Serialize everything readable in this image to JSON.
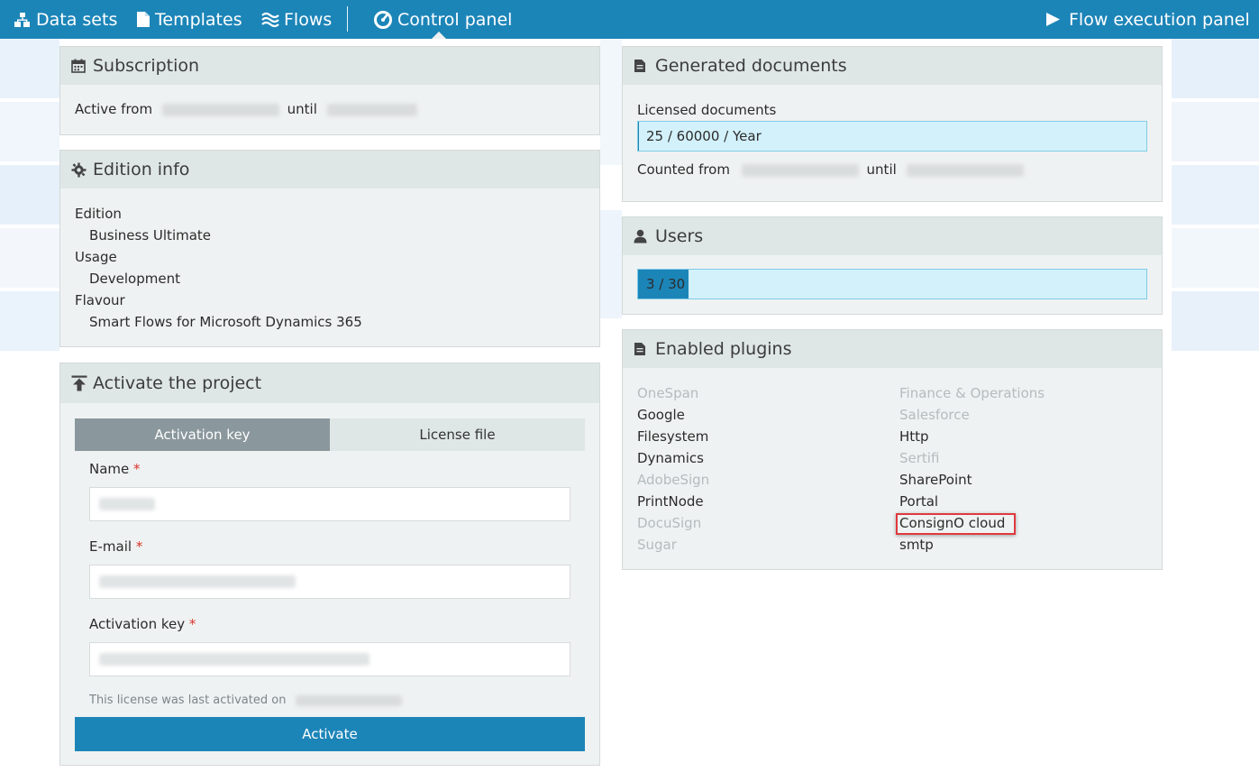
{
  "nav": {
    "items": [
      {
        "label": "Data sets",
        "icon": "sitemap-icon"
      },
      {
        "label": "Templates",
        "icon": "file-icon"
      },
      {
        "label": "Flows",
        "icon": "waves-icon"
      },
      {
        "label": "Control panel",
        "icon": "gauge-icon"
      }
    ],
    "right": {
      "label": "Flow execution panel",
      "icon": "play-icon"
    }
  },
  "subscription": {
    "title": "Subscription",
    "active_from_label": "Active from",
    "until_label": "until"
  },
  "edition": {
    "title": "Edition info",
    "edition_label": "Edition",
    "edition_value": "Business Ultimate",
    "usage_label": "Usage",
    "usage_value": "Development",
    "flavour_label": "Flavour",
    "flavour_value": "Smart Flows for Microsoft Dynamics 365"
  },
  "activate": {
    "title": "Activate the project",
    "tabs": [
      "Activation key",
      "License file"
    ],
    "active_tab": 0,
    "name_label": "Name",
    "email_label": "E-mail",
    "key_label": "Activation key",
    "required_mark": "*",
    "last_activated": "This license was last activated on",
    "button": "Activate"
  },
  "documents": {
    "title": "Generated documents",
    "licensed_label": "Licensed documents",
    "licensed_value": "25 / 60000 / Year",
    "used_fraction": 0.0004,
    "counted_from_label": "Counted from",
    "until_label": "until"
  },
  "users": {
    "title": "Users",
    "value": "3 / 30",
    "fraction": 0.1
  },
  "plugins": {
    "title": "Enabled plugins",
    "left": [
      {
        "name": "OneSpan",
        "enabled": false
      },
      {
        "name": "Google",
        "enabled": true
      },
      {
        "name": "Filesystem",
        "enabled": true
      },
      {
        "name": "Dynamics",
        "enabled": true
      },
      {
        "name": "AdobeSign",
        "enabled": false
      },
      {
        "name": "PrintNode",
        "enabled": true
      },
      {
        "name": "DocuSign",
        "enabled": false
      },
      {
        "name": "Sugar",
        "enabled": false
      }
    ],
    "right": [
      {
        "name": "Finance & Operations",
        "enabled": false
      },
      {
        "name": "Salesforce",
        "enabled": false
      },
      {
        "name": "Http",
        "enabled": true
      },
      {
        "name": "Sertifi",
        "enabled": false
      },
      {
        "name": "SharePoint",
        "enabled": true
      },
      {
        "name": "Portal",
        "enabled": true
      },
      {
        "name": "ConsignO cloud",
        "enabled": true
      },
      {
        "name": "smtp",
        "enabled": true
      }
    ],
    "highlighted": "ConsignO cloud"
  },
  "colors": {
    "brand": "#1c85b8",
    "panel": "#eff2f2",
    "panel_header": "#dfe6e6",
    "progress_track": "#d3f1fb",
    "highlight": "#e0393e",
    "disabled_text": "#b4bcbe"
  }
}
